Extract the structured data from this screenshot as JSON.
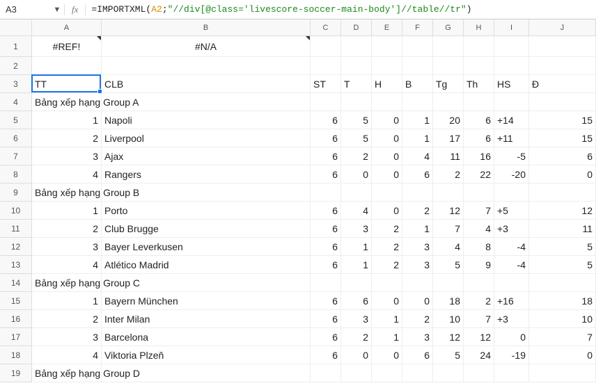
{
  "namebox": "A3",
  "fx_label": "fx",
  "formula": {
    "prefix": "=",
    "fn": "IMPORTXML",
    "ref": "A2",
    "sep": ";",
    "str": "\"//div[@class='livescore-soccer-main-body']//table//tr\""
  },
  "columns": [
    "A",
    "B",
    "C",
    "D",
    "E",
    "F",
    "G",
    "H",
    "I",
    "J"
  ],
  "row_count": 19,
  "row1": {
    "A": "#REF!",
    "B": "#N/A"
  },
  "headers": {
    "A": "TT",
    "B": "CLB",
    "C": "ST",
    "D": "T",
    "E": "H",
    "F": "B",
    "G": "Tg",
    "H": "Th",
    "I": "HS",
    "J": "Đ"
  },
  "groups": [
    {
      "title": "Bảng xếp hạng Group A",
      "title_row": 4,
      "rows": [
        {
          "n": 5,
          "tt": 1,
          "clb": "Napoli",
          "st": 6,
          "t": 5,
          "h": 0,
          "b": 1,
          "tg": 20,
          "th": 6,
          "hs": "+14",
          "d": 15
        },
        {
          "n": 6,
          "tt": 2,
          "clb": "Liverpool",
          "st": 6,
          "t": 5,
          "h": 0,
          "b": 1,
          "tg": 17,
          "th": 6,
          "hs": "+11",
          "d": 15
        },
        {
          "n": 7,
          "tt": 3,
          "clb": "Ajax",
          "st": 6,
          "t": 2,
          "h": 0,
          "b": 4,
          "tg": 11,
          "th": 16,
          "hs": "-5",
          "d": 6
        },
        {
          "n": 8,
          "tt": 4,
          "clb": "Rangers",
          "st": 6,
          "t": 0,
          "h": 0,
          "b": 6,
          "tg": 2,
          "th": 22,
          "hs": "-20",
          "d": 0
        }
      ]
    },
    {
      "title": "Bảng xếp hạng Group B",
      "title_row": 9,
      "rows": [
        {
          "n": 10,
          "tt": 1,
          "clb": "Porto",
          "st": 6,
          "t": 4,
          "h": 0,
          "b": 2,
          "tg": 12,
          "th": 7,
          "hs": "+5",
          "d": 12
        },
        {
          "n": 11,
          "tt": 2,
          "clb": "Club Brugge",
          "st": 6,
          "t": 3,
          "h": 2,
          "b": 1,
          "tg": 7,
          "th": 4,
          "hs": "+3",
          "d": 11
        },
        {
          "n": 12,
          "tt": 3,
          "clb": "Bayer Leverkusen",
          "st": 6,
          "t": 1,
          "h": 2,
          "b": 3,
          "tg": 4,
          "th": 8,
          "hs": "-4",
          "d": 5
        },
        {
          "n": 13,
          "tt": 4,
          "clb": "Atlético Madrid",
          "st": 6,
          "t": 1,
          "h": 2,
          "b": 3,
          "tg": 5,
          "th": 9,
          "hs": "-4",
          "d": 5
        }
      ]
    },
    {
      "title": "Bảng xếp hạng Group C",
      "title_row": 14,
      "rows": [
        {
          "n": 15,
          "tt": 1,
          "clb": "Bayern München",
          "st": 6,
          "t": 6,
          "h": 0,
          "b": 0,
          "tg": 18,
          "th": 2,
          "hs": "+16",
          "d": 18
        },
        {
          "n": 16,
          "tt": 2,
          "clb": "Inter Milan",
          "st": 6,
          "t": 3,
          "h": 1,
          "b": 2,
          "tg": 10,
          "th": 7,
          "hs": "+3",
          "d": 10
        },
        {
          "n": 17,
          "tt": 3,
          "clb": "Barcelona",
          "st": 6,
          "t": 2,
          "h": 1,
          "b": 3,
          "tg": 12,
          "th": 12,
          "hs": "0",
          "d": 7
        },
        {
          "n": 18,
          "tt": 4,
          "clb": "Viktoria Plzeň",
          "st": 6,
          "t": 0,
          "h": 0,
          "b": 6,
          "tg": 5,
          "th": 24,
          "hs": "-19",
          "d": 0
        }
      ]
    },
    {
      "title": "Bảng xếp hạng Group D",
      "title_row": 19,
      "rows": []
    }
  ],
  "active_cell": "A3"
}
